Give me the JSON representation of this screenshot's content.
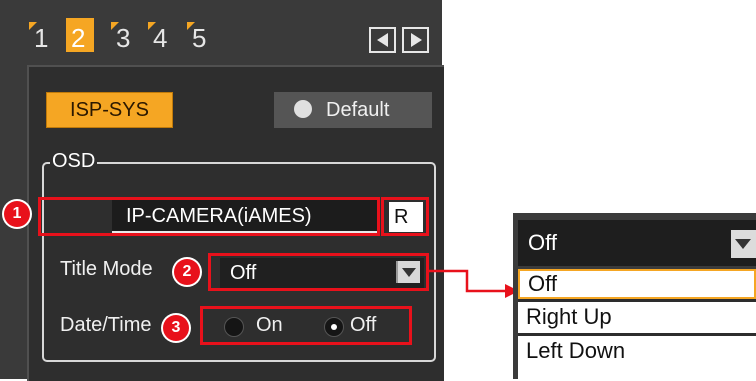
{
  "tabs": [
    {
      "label": "1",
      "active": false
    },
    {
      "label": "2",
      "active": true
    },
    {
      "label": "3",
      "active": false
    },
    {
      "label": "4",
      "active": false
    },
    {
      "label": "5",
      "active": false
    }
  ],
  "nav": {
    "prev_icon": "triangle-left-icon",
    "next_icon": "triangle-right-icon"
  },
  "buttons": {
    "isp_sys": "ISP-SYS",
    "default": "Default",
    "default_icon": "reset-icon"
  },
  "osd": {
    "group_label": "OSD",
    "camera_title": "IP-CAMERA(iAMES)",
    "reset_button": "R",
    "title_mode_label": "Title Mode",
    "title_mode_value": "Off",
    "datetime_label": "Date/Time",
    "datetime_on": "On",
    "datetime_off": "Off",
    "datetime_selected": "Off"
  },
  "callouts": [
    "1",
    "2",
    "3"
  ],
  "dropdown_popup": {
    "selected": "Off",
    "options": [
      "Off",
      "Right Up",
      "Left Down"
    ],
    "highlighted": "Off"
  },
  "colors": {
    "accent": "#f5a623",
    "callout": "#e8111b",
    "panel": "#3a3a3a"
  }
}
